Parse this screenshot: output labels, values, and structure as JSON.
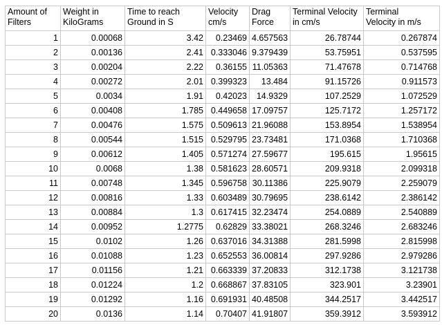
{
  "table": {
    "headers": [
      [
        "Amount of",
        "Filters"
      ],
      [
        "Weight in",
        "KiloGrams"
      ],
      [
        "Time to reach",
        "Ground in S"
      ],
      [
        "Velocity",
        "cm/s"
      ],
      [
        "Drag",
        "Force"
      ],
      [
        "Terminal Velocity",
        "in cm/s"
      ],
      [
        "Terminal",
        "Velocity in m/s"
      ]
    ],
    "rows": [
      [
        "1",
        "0.00068",
        "3.42",
        "0.23469",
        "4.657563",
        "26.78744",
        "0.267874"
      ],
      [
        "2",
        "0.00136",
        "2.41",
        "0.333046",
        "9.379439",
        "53.75951",
        "0.537595"
      ],
      [
        "3",
        "0.00204",
        "2.22",
        "0.36155",
        "11.05363",
        "71.47678",
        "0.714768"
      ],
      [
        "4",
        "0.00272",
        "2.01",
        "0.399323",
        "13.484",
        "91.15726",
        "0.911573"
      ],
      [
        "5",
        "0.0034",
        "1.91",
        "0.42023",
        "14.9329",
        "107.2529",
        "1.072529"
      ],
      [
        "6",
        "0.00408",
        "1.785",
        "0.449658",
        "17.09757",
        "125.7172",
        "1.257172"
      ],
      [
        "7",
        "0.00476",
        "1.575",
        "0.509613",
        "21.96088",
        "153.8954",
        "1.538954"
      ],
      [
        "8",
        "0.00544",
        "1.515",
        "0.529795",
        "23.73481",
        "171.0368",
        "1.710368"
      ],
      [
        "9",
        "0.00612",
        "1.405",
        "0.571274",
        "27.59677",
        "195.615",
        "1.95615"
      ],
      [
        "10",
        "0.0068",
        "1.38",
        "0.581623",
        "28.60571",
        "209.9318",
        "2.099318"
      ],
      [
        "11",
        "0.00748",
        "1.345",
        "0.596758",
        "30.11386",
        "225.9079",
        "2.259079"
      ],
      [
        "12",
        "0.00816",
        "1.33",
        "0.603489",
        "30.79695",
        "238.6142",
        "2.386142"
      ],
      [
        "13",
        "0.00884",
        "1.3",
        "0.617415",
        "32.23474",
        "254.0889",
        "2.540889"
      ],
      [
        "14",
        "0.00952",
        "1.2775",
        "0.62829",
        "33.38021",
        "268.3246",
        "2.683246"
      ],
      [
        "15",
        "0.0102",
        "1.26",
        "0.637016",
        "34.31388",
        "281.5998",
        "2.815998"
      ],
      [
        "16",
        "0.01088",
        "1.23",
        "0.652553",
        "36.00814",
        "297.9286",
        "2.979286"
      ],
      [
        "17",
        "0.01156",
        "1.21",
        "0.663339",
        "37.20833",
        "312.1738",
        "3.121738"
      ],
      [
        "18",
        "0.01224",
        "1.2",
        "0.668867",
        "37.83105",
        "323.901",
        "3.23901"
      ],
      [
        "19",
        "0.01292",
        "1.16",
        "0.691931",
        "40.48508",
        "344.2517",
        "3.442517"
      ],
      [
        "20",
        "0.0136",
        "1.14",
        "0.70407",
        "41.91807",
        "359.3912",
        "3.593912"
      ]
    ]
  }
}
